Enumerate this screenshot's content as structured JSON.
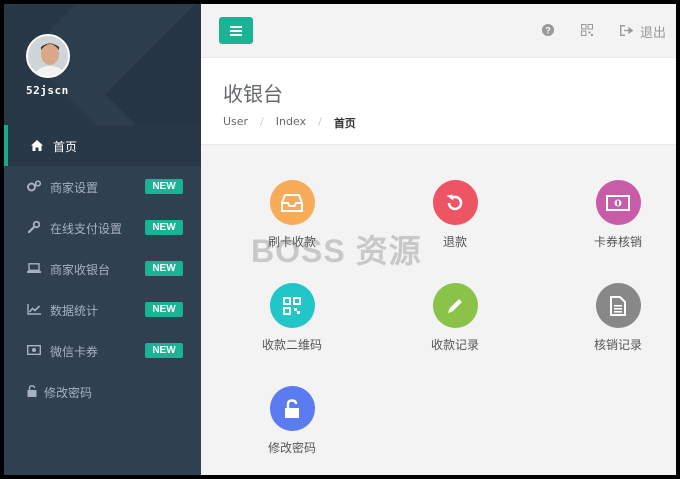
{
  "user": {
    "name": "52jscn"
  },
  "sidebar": {
    "items": [
      {
        "label": "首页",
        "icon": "home-icon",
        "badge": ""
      },
      {
        "label": "商家设置",
        "icon": "cogs-icon",
        "badge": "NEW"
      },
      {
        "label": "在线支付设置",
        "icon": "wrench-icon",
        "badge": "NEW"
      },
      {
        "label": "商家收银台",
        "icon": "laptop-icon",
        "badge": "NEW"
      },
      {
        "label": "数据统计",
        "icon": "line-chart-icon",
        "badge": "NEW"
      },
      {
        "label": "微信卡券",
        "icon": "money-icon",
        "badge": "NEW"
      },
      {
        "label": "修改密码",
        "icon": "unlock-icon",
        "badge": ""
      }
    ]
  },
  "topbar": {
    "logout_label": "退出"
  },
  "heading": {
    "title": "收银台",
    "breadcrumb": [
      "User",
      "Index",
      "首页"
    ]
  },
  "tiles": [
    {
      "label": "刷卡收款",
      "icon": "inbox-icon",
      "color": "#f8ac59"
    },
    {
      "label": "退款",
      "icon": "undo-icon",
      "color": "#ed5565"
    },
    {
      "label": "卡券核销",
      "icon": "money-icon",
      "color": "#c85ca8"
    },
    {
      "label": "收款二维码",
      "icon": "qrcode-icon",
      "color": "#23c6c8"
    },
    {
      "label": "收款记录",
      "icon": "pencil-icon",
      "color": "#8bc34a"
    },
    {
      "label": "核销记录",
      "icon": "file-icon",
      "color": "#888888"
    },
    {
      "label": "修改密码",
      "icon": "unlock-icon",
      "color": "#5b7cf0"
    }
  ],
  "watermark": "BOSS 资源",
  "colors": {
    "sidebar": "#2f4050",
    "accent": "#1ab394"
  }
}
